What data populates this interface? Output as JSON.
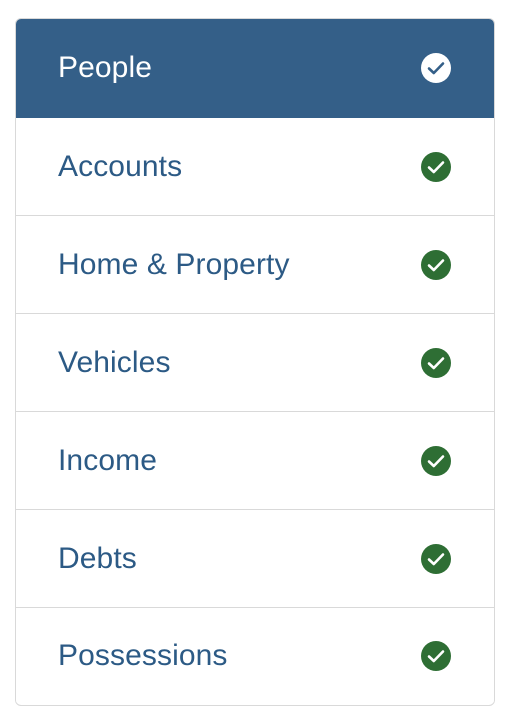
{
  "nav": {
    "items": [
      {
        "label": "People",
        "active": true,
        "status_icon": "check-circle-icon"
      },
      {
        "label": "Accounts",
        "active": false,
        "status_icon": "check-circle-icon"
      },
      {
        "label": "Home & Property",
        "active": false,
        "status_icon": "check-circle-icon"
      },
      {
        "label": "Vehicles",
        "active": false,
        "status_icon": "check-circle-icon"
      },
      {
        "label": "Income",
        "active": false,
        "status_icon": "check-circle-icon"
      },
      {
        "label": "Debts",
        "active": false,
        "status_icon": "check-circle-icon"
      },
      {
        "label": "Possessions",
        "active": false,
        "status_icon": "check-circle-icon"
      }
    ]
  },
  "colors": {
    "active_background": "#345f88",
    "label_text": "#2c5a85",
    "check_complete": "#2e6e34",
    "check_active": "#ffffff",
    "border": "#d9d9d9"
  }
}
